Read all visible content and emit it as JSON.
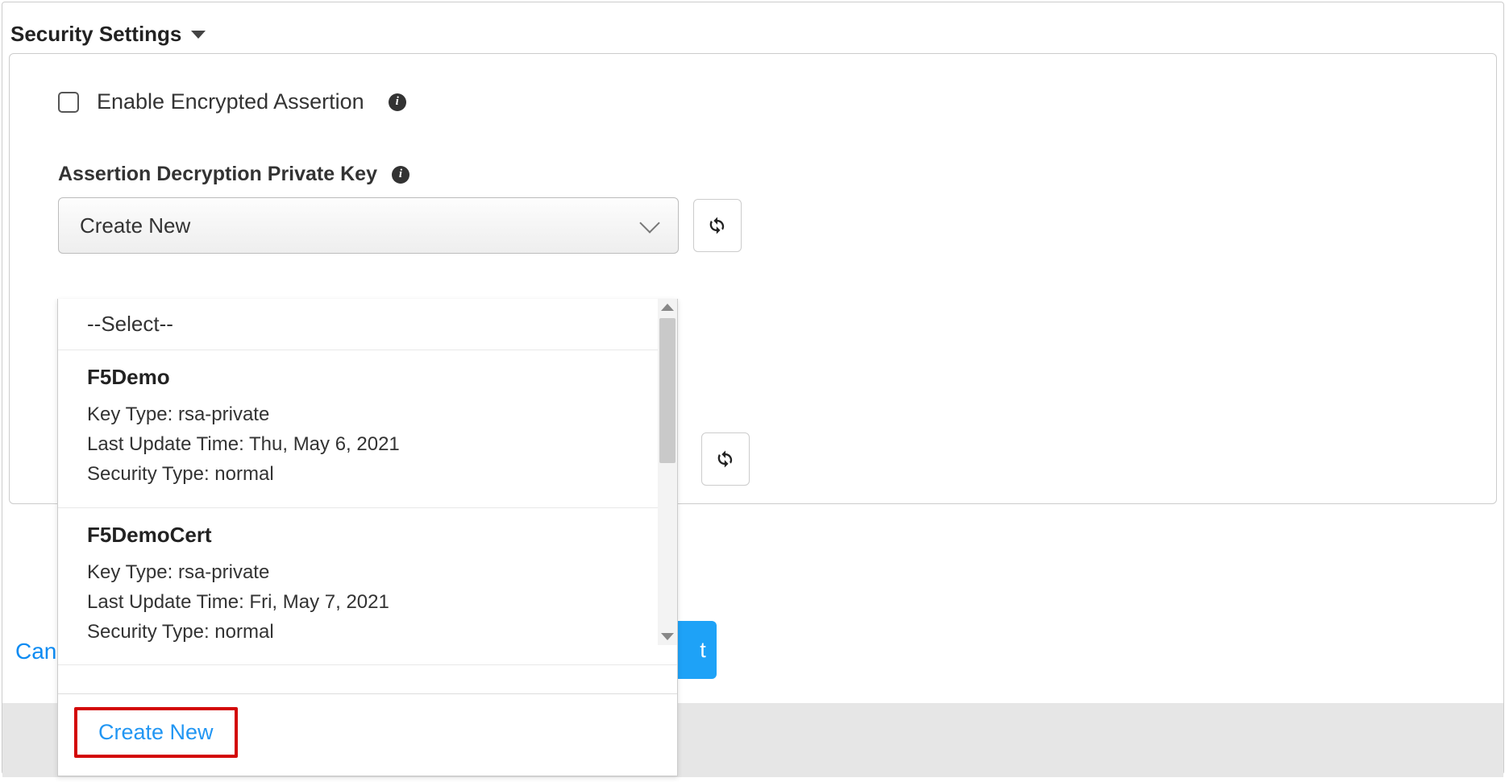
{
  "section": {
    "title": "Security Settings"
  },
  "enable_encrypted": {
    "label": "Enable Encrypted Assertion"
  },
  "assertion_key": {
    "label": "Assertion Decryption Private Key",
    "selected": "Create New"
  },
  "dropdown": {
    "placeholder": "--Select--",
    "options": [
      {
        "name": "F5Demo",
        "key_type": "Key Type: rsa-private",
        "last_update": "Last Update Time: Thu, May 6, 2021",
        "security_type": "Security Type: normal"
      },
      {
        "name": "F5DemoCert",
        "key_type": "Key Type: rsa-private",
        "last_update": "Last Update Time: Fri, May 7, 2021",
        "security_type": "Security Type: normal"
      }
    ],
    "create_new": "Create New"
  },
  "footer": {
    "cancel_fragment": "Can",
    "next_fragment": "t"
  }
}
